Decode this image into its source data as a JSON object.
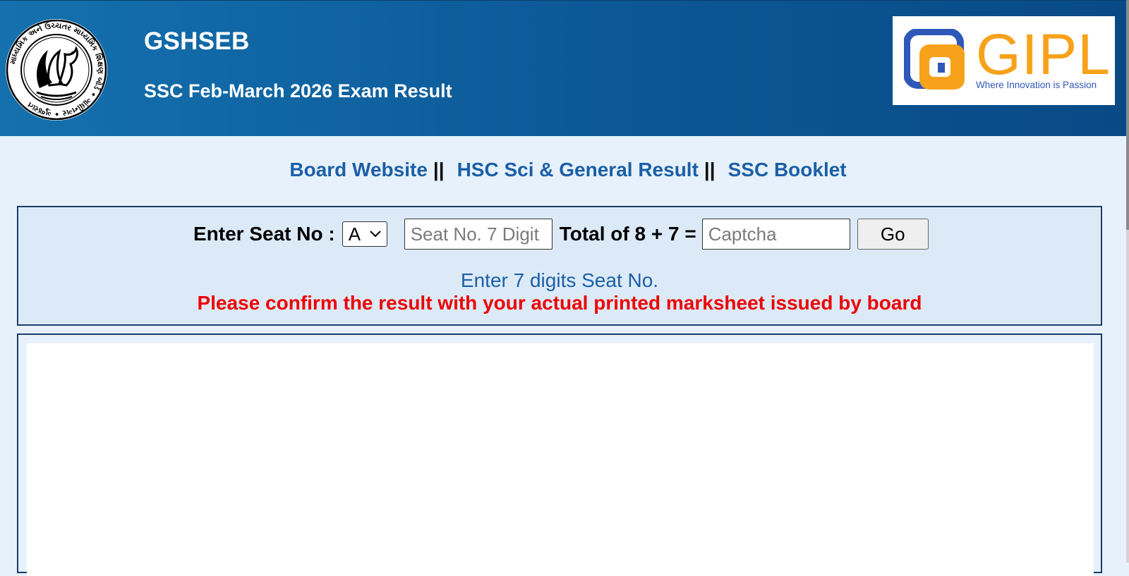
{
  "header": {
    "brand": "GSHSEB",
    "subtitle": "SSC Feb-March 2026 Exam Result",
    "seal_text": "માધ્યમિક અને ઉચ્ચતર માધ્યમિક શિક્ષણ બોર્ડ • ગાંધીનગર • ગુજરાત",
    "partner_logo": {
      "name": "GIPL",
      "tagline": "Where Innovation is Passion",
      "color_primary": "#f7a21b",
      "color_secondary": "#2f57b8"
    }
  },
  "links": [
    {
      "label": "Board Website"
    },
    {
      "label": "HSC Sci & General Result"
    },
    {
      "label": "SSC Booklet"
    }
  ],
  "link_separator": "||",
  "form": {
    "seat_label": "Enter Seat No :",
    "series_value": "A",
    "seat_placeholder": "Seat No. 7 Digit",
    "captcha_label": "Total of 8 + 7 =",
    "captcha_placeholder": "Captcha",
    "go_label": "Go",
    "hint": "Enter 7 digits Seat No.",
    "warning": "Please confirm the result with your actual printed marksheet issued by board"
  },
  "colors": {
    "header_bg": "#0c5796",
    "link": "#1b5fa6",
    "warning": "#e00000",
    "panel_bg": "#dceaf8"
  }
}
